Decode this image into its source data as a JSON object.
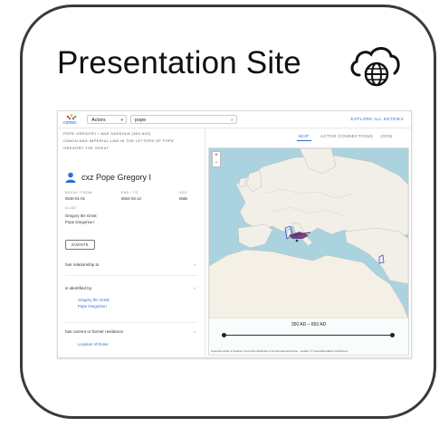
{
  "title": "Presentation Site",
  "icons": {
    "cloud": "cloud-globe-icon",
    "person": "person-icon",
    "search": "search-icon"
  },
  "colors": {
    "accent": "#2a6fd6",
    "water": "#aad3df",
    "land": "#f2efe9",
    "route": "#5a2a6e"
  },
  "app": {
    "logo": "comec",
    "entity_select": "Actors",
    "search_value": "pope",
    "explore": "EXPLORE ALL ENTRIES",
    "breadcrumbs": [
      "POPE GREGORY I AND SARDINIA (590-603)",
      "CANON AND IMPERIAL LAW IN THE LETTERS OF POPE",
      "GREGORY THE GREAT"
    ],
    "person_name": "cxz Pope Gregory I",
    "fields": {
      "begin_label": "BEGIN / FROM",
      "begin_value": "0540-01-01",
      "end_label": "END / TO",
      "end_value": "0604-03-12",
      "sex_label": "SEX",
      "sex_value": "Male"
    },
    "alias_label": "ALIAS",
    "aliases": [
      "Gregory the Great",
      "Pope Gregorius I"
    ],
    "events_button": "EVENTS",
    "relationships": [
      {
        "label": "has relationship to",
        "chevron": "˅",
        "links": []
      },
      {
        "label": "is identified by",
        "chevron": "˄",
        "links": [
          "Gregory the Great",
          "Pope Gregorius I"
        ]
      },
      {
        "label": "has current or former residence",
        "chevron": "˄",
        "links": [
          "Location of Rome"
        ]
      }
    ],
    "tabs": [
      "MAP",
      "ACTOR CONNECTIONS",
      "JSON"
    ],
    "active_tab": "MAP",
    "map": {
      "zoom_in": "+",
      "zoom_out": "−",
      "range_label": "350 AD – 650 AD",
      "attribution": "Licensed under a Creative Commons Attribution 4.0 International license · Leaflet | © OpenStreetMap contributors"
    }
  }
}
